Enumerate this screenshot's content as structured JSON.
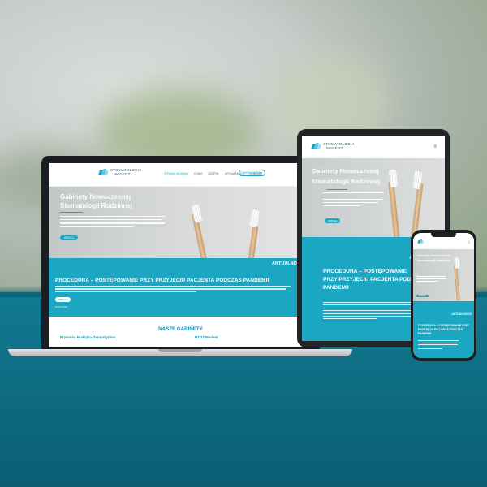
{
  "brand": {
    "logo_line1": "STOMATOLOGIA",
    "logo_line2": "MADENT",
    "accent_color": "#1ba6c1",
    "dark_accent": "#1590a8"
  },
  "nav": {
    "items": [
      "STRONA GŁÓWNA",
      "O NAS",
      "ZESPÓŁ",
      "AKTUALNOŚCI",
      "KONTAKT"
    ],
    "active_index": 0,
    "cta_label": "UMÓW WIZYTĘ"
  },
  "hero": {
    "title_line1": "Gabinety Nowoczesnej",
    "title_line2": "Stomatologii Rodzinnej",
    "button_label": "WIĘCEJ"
  },
  "news": {
    "section_title": "AKTUALNOŚCI",
    "heading": "PROCEDURA – POSTĘPOWANIE PRZY PRZYJĘCIU PACJENTA PODCZAS PANDEMII",
    "button_label": "WIĘCEJ",
    "date": "01.06.2020"
  },
  "offices": {
    "section_title": "NASZE GABINETY",
    "office1": "Prywatna Praktyka Dentystyczna",
    "office2": "NZOZ Madent"
  },
  "tablet": {
    "heading_line1": "PROCEDURA – POSTĘPOWANIE",
    "heading_line2": "PRZY PRZYJĘCIU PACJENTA PODCZA",
    "heading_line3": "PANDEMII"
  },
  "phone": {
    "heading": "PROCEDURA – POSTĘPOWANIE PRZY PRZYJĘCIU PACJENTA PODCZAS PANDEMII"
  },
  "icons": {
    "hamburger": "hamburger-icon",
    "logo": "tooth-logo-icon"
  }
}
